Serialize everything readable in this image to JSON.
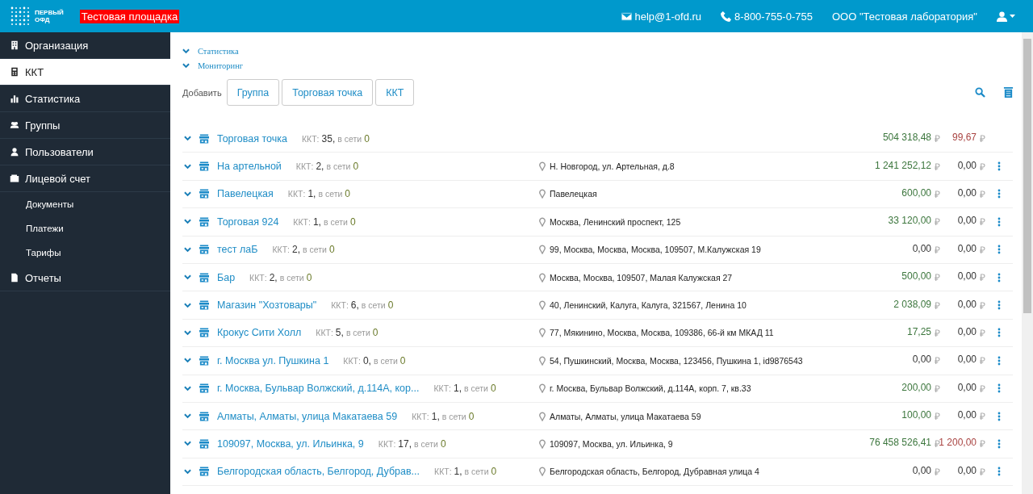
{
  "header": {
    "logo_text": [
      "ПЕРВЫЙ",
      "ОФД"
    ],
    "badge": "Тестовая площадка",
    "email": "help@1-ofd.ru",
    "phone": "8-800-755-0-755",
    "organization": "ООО \"Тестовая лаборатория\""
  },
  "sidebar": {
    "items": [
      {
        "label": "Организация",
        "selected": false
      },
      {
        "label": "ККТ",
        "selected": true
      },
      {
        "label": "Статистика",
        "selected": false
      },
      {
        "label": "Группы",
        "selected": false
      },
      {
        "label": "Пользователи",
        "selected": false
      },
      {
        "label": "Лицевой счет",
        "selected": false,
        "children": [
          {
            "label": "Документы"
          },
          {
            "label": "Платежи"
          },
          {
            "label": "Тарифы"
          }
        ]
      },
      {
        "label": "Отчеты",
        "selected": false
      }
    ]
  },
  "sections": [
    {
      "label": "Статистика"
    },
    {
      "label": "Мониторинг"
    }
  ],
  "add_bar": {
    "label": "Добавить",
    "buttons": [
      "Группа",
      "Торговая точка",
      "ККТ"
    ]
  },
  "rows": [
    {
      "kind": "summary",
      "name": "Торговая точка",
      "kkt_label": "ККТ:",
      "kkt_count": "35,",
      "online_label": "в сети",
      "online_count": "0",
      "revenue": {
        "value": "504 318,48",
        "currency": "₽",
        "color": "#3c763d"
      },
      "refund": {
        "value": "99,67",
        "currency": "₽",
        "color": "#a94442"
      }
    },
    {
      "kind": "point",
      "name": "На артельной",
      "kkt_label": "ККТ:",
      "kkt_count": "2,",
      "online_label": "в сети",
      "online_count": "0",
      "address": "Н. Новгород, ул. Артельная, д.8",
      "revenue": {
        "value": "1 241 252,12",
        "currency": "₽",
        "color": "#3c763d"
      },
      "refund": {
        "value": "0,00",
        "currency": "₽",
        "color": "#333333"
      }
    },
    {
      "kind": "point",
      "name": "Павелецкая",
      "kkt_label": "ККТ:",
      "kkt_count": "1,",
      "online_label": "в сети",
      "online_count": "0",
      "address": "Павелецкая",
      "revenue": {
        "value": "600,00",
        "currency": "₽",
        "color": "#3c763d"
      },
      "refund": {
        "value": "0,00",
        "currency": "₽",
        "color": "#333333"
      }
    },
    {
      "kind": "point",
      "name": "Торговая 924",
      "kkt_label": "ККТ:",
      "kkt_count": "1,",
      "online_label": "в сети",
      "online_count": "0",
      "address": "Москва, Ленинский проспект, 125",
      "revenue": {
        "value": "33 120,00",
        "currency": "₽",
        "color": "#3c763d"
      },
      "refund": {
        "value": "0,00",
        "currency": "₽",
        "color": "#333333"
      }
    },
    {
      "kind": "point",
      "name": "тест лаБ",
      "kkt_label": "ККТ:",
      "kkt_count": "2,",
      "online_label": "в сети",
      "online_count": "0",
      "address": "99, Москва, Москва, Москва, 109507, М.Калужская 19",
      "revenue": {
        "value": "0,00",
        "currency": "₽",
        "color": "#333333"
      },
      "refund": {
        "value": "0,00",
        "currency": "₽",
        "color": "#333333"
      }
    },
    {
      "kind": "point",
      "name": "Бар",
      "kkt_label": "ККТ:",
      "kkt_count": "2,",
      "online_label": "в сети",
      "online_count": "0",
      "address": "Москва, Москва, 109507, Малая Калужская 27",
      "revenue": {
        "value": "500,00",
        "currency": "₽",
        "color": "#3c763d"
      },
      "refund": {
        "value": "0,00",
        "currency": "₽",
        "color": "#333333"
      }
    },
    {
      "kind": "point",
      "name": "Магазин \"Хозтовары\"",
      "kkt_label": "ККТ:",
      "kkt_count": "6,",
      "online_label": "в сети",
      "online_count": "0",
      "address": "40, Ленинский, Калуга, Калуга, 321567, Ленина 10",
      "revenue": {
        "value": "2 038,09",
        "currency": "₽",
        "color": "#3c763d"
      },
      "refund": {
        "value": "0,00",
        "currency": "₽",
        "color": "#333333"
      }
    },
    {
      "kind": "point",
      "name": "Крокус Сити Холл",
      "kkt_label": "ККТ:",
      "kkt_count": "5,",
      "online_label": "в сети",
      "online_count": "0",
      "address": "77, Мякинино, Москва, Москва, 109386, 66-й км МКАД 11",
      "revenue": {
        "value": "17,25",
        "currency": "₽",
        "color": "#3c763d"
      },
      "refund": {
        "value": "0,00",
        "currency": "₽",
        "color": "#333333"
      }
    },
    {
      "kind": "point",
      "name": "г. Москва ул. Пушкина 1",
      "kkt_label": "ККТ:",
      "kkt_count": "0,",
      "online_label": "в сети",
      "online_count": "0",
      "address": "54, Пушкинский, Москва, Москва, 123456, Пушкина 1, id9876543",
      "revenue": {
        "value": "0,00",
        "currency": "₽",
        "color": "#333333"
      },
      "refund": {
        "value": "0,00",
        "currency": "₽",
        "color": "#333333"
      }
    },
    {
      "kind": "point",
      "name": "г. Москва, Бульвар Волжский, д.114А, кор...",
      "kkt_label": "ККТ:",
      "kkt_count": "1,",
      "online_label": "в сети",
      "online_count": "0",
      "address": "г. Москва, Бульвар Волжский, д.114А, корп. 7, кв.33",
      "revenue": {
        "value": "200,00",
        "currency": "₽",
        "color": "#3c763d"
      },
      "refund": {
        "value": "0,00",
        "currency": "₽",
        "color": "#333333"
      }
    },
    {
      "kind": "point",
      "name": "Алматы, Алматы, улица Макатаева 59",
      "kkt_label": "ККТ:",
      "kkt_count": "1,",
      "online_label": "в сети",
      "online_count": "0",
      "address": "Алматы, Алматы, улица Макатаева 59",
      "revenue": {
        "value": "100,00",
        "currency": "₽",
        "color": "#3c763d"
      },
      "refund": {
        "value": "0,00",
        "currency": "₽",
        "color": "#333333"
      }
    },
    {
      "kind": "point",
      "name": "109097, Москва, ул. Ильинка, 9",
      "kkt_label": "ККТ:",
      "kkt_count": "17,",
      "online_label": "в сети",
      "online_count": "0",
      "address": "109097, Москва, ул. Ильинка, 9",
      "revenue": {
        "value": "76 458 526,41",
        "currency": "₽",
        "color": "#3c763d"
      },
      "refund": {
        "value": "1 200,00",
        "currency": "₽",
        "color": "#a94442"
      }
    },
    {
      "kind": "point",
      "name": "Белгородская область, Белгород, Дубрав...",
      "kkt_label": "ККТ:",
      "kkt_count": "1,",
      "online_label": "в сети",
      "online_count": "0",
      "address": "Белгородская область, Белгород, Дубравная улица 4",
      "revenue": {
        "value": "0,00",
        "currency": "₽",
        "color": "#333333"
      },
      "refund": {
        "value": "0,00",
        "currency": "₽",
        "color": "#333333"
      }
    }
  ]
}
